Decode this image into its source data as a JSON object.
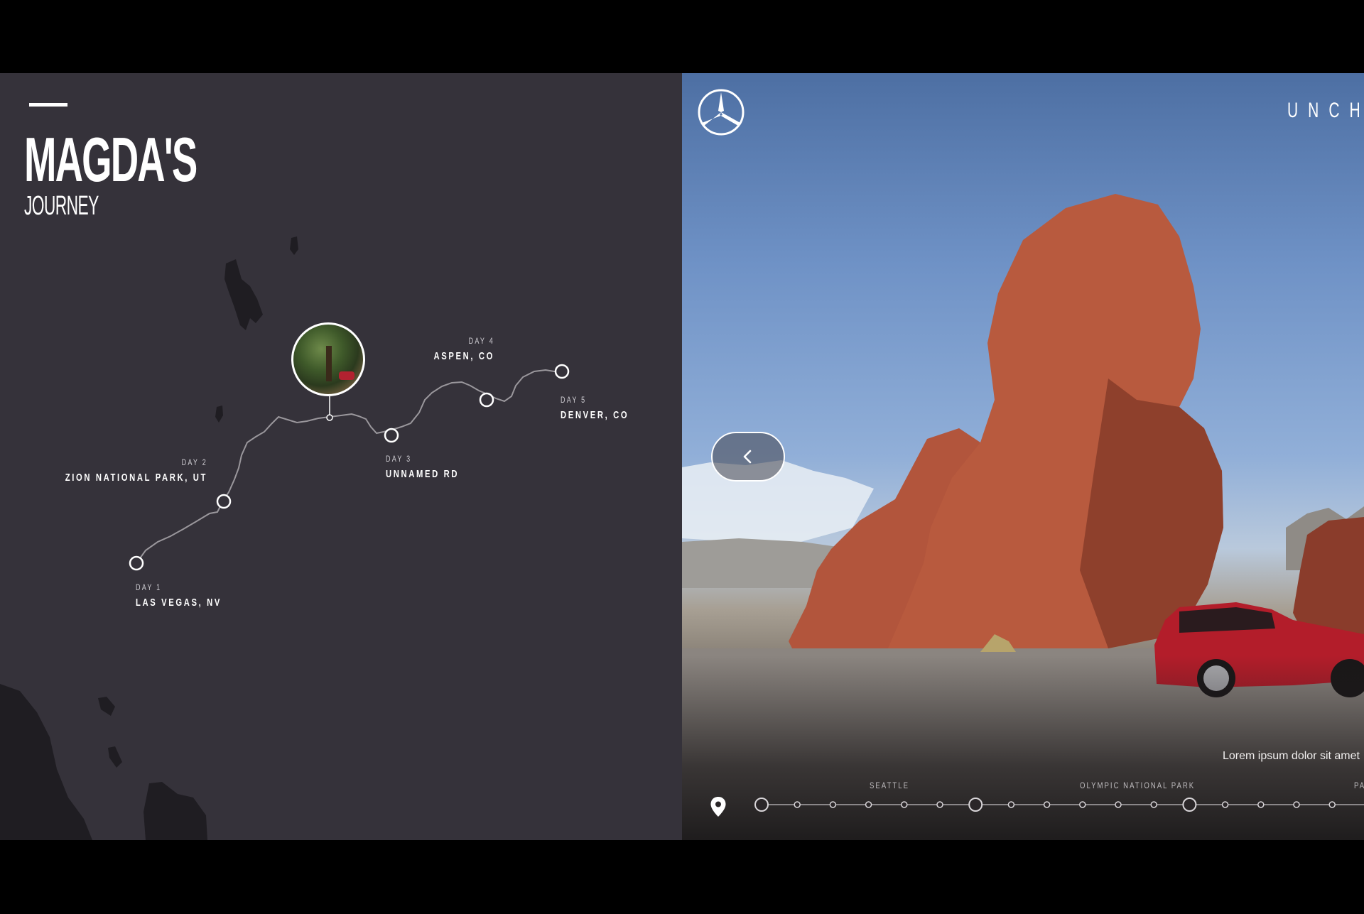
{
  "journey": {
    "title": "MAGDA'S",
    "subtitle": "JOURNEY",
    "stops": [
      {
        "day": "DAY 1",
        "place": "LAS VEGAS, NV"
      },
      {
        "day": "DAY 2",
        "place": "ZION NATIONAL PARK, UT"
      },
      {
        "day": "DAY 3",
        "place": "UNNAMED RD"
      },
      {
        "day": "DAY 4",
        "place": "ASPEN, CO"
      },
      {
        "day": "DAY 5",
        "place": "DENVER, CO"
      }
    ]
  },
  "photo": {
    "brand_text": "UNCHA",
    "caption": "Lorem ipsum dolor sit amet",
    "timeline": {
      "labels": [
        "SEATTLE",
        "OLYMPIC NATIONAL PARK",
        "PA"
      ]
    }
  },
  "icons": {
    "logo": "mercedes-star-icon",
    "back": "chevron-left-icon",
    "location": "map-pin-icon"
  },
  "colors": {
    "map_background": "#35323a",
    "route_line": "#9a979c",
    "accent_white": "#ffffff"
  }
}
